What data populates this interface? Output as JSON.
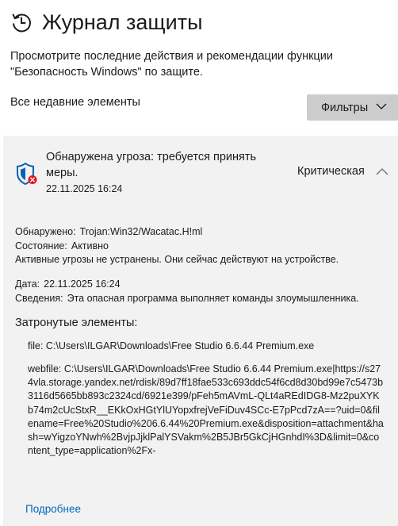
{
  "header": {
    "icon": "history-clock-icon",
    "title": "Журнал защиты",
    "description": "Просмотрите последние действия и рекомендации функции \"Безопасность Windows\" по защите."
  },
  "toolbar": {
    "section_label": "Все недавние элементы",
    "filters_label": "Фильтры"
  },
  "threat": {
    "icon": "shield-error-icon",
    "title": "Обнаружена угроза: требуется принять меры.",
    "date": "22.11.2025 16:24",
    "severity": "Критическая",
    "detected_label": "Обнаружено:",
    "detected_value": "Trojan:Win32/Wacatac.H!ml",
    "status_label": "Состояние:",
    "status_value": "Активно",
    "active_note": "Активные угрозы не устранены. Они сейчас действуют на устройстве.",
    "date_label": "Дата:",
    "date_value": "22.11.2025 16:24",
    "details_label": "Сведения:",
    "details_value": "Эта опасная программа выполняет команды злоумышленника.",
    "affected_heading": "Затронутые элементы:",
    "file_item": "file: C:\\Users\\ILGAR\\Downloads\\Free Studio 6.6.44 Premium.exe",
    "webfile_item": "webfile: C:\\Users\\ILGAR\\Downloads\\Free Studio 6.6.44 Premium.exe|https://s274vla.storage.yandex.net/rdisk/89d7ff18fae533c693ddc54f6cd8d30bd99e7c5473b3116d5665bb893c2324cd/6921e399/pFeh5mAVmL-QLt4aREdIDG8-Mz2puXYKb74m2cUcStxR__EKkOxHGtYlUYopxfrejVeFiDuv4SCc-E7pPcd7zA==?uid=0&filename=Free%20Studio%206.6.44%20Premium.exe&disposition=attachment&hash=wYigzoYNwh%2BvjpJjklPalYSVakm%2B5JBr5GkCjHGnhdI%3D&limit=0&content_type=application%2Fx-",
    "more_link": "Подробнее"
  },
  "colors": {
    "card_background": "#f2f2f2",
    "filters_button": "#cccccc",
    "shield_blue": "#0063b1",
    "error_red": "#e81123",
    "link_blue": "#0067c0"
  }
}
